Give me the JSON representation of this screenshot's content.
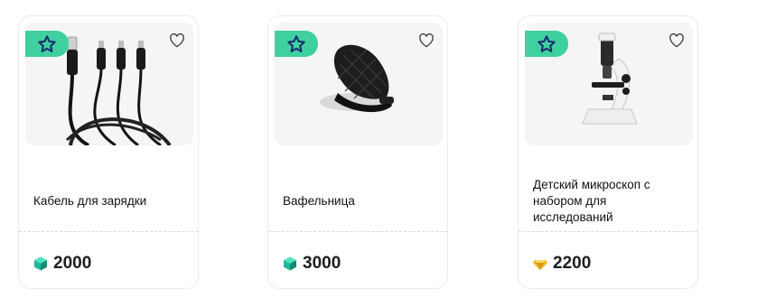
{
  "products": [
    {
      "title": "Кабель для зарядки",
      "price": "2000",
      "currency_icon": "green-gem-icon",
      "badge_icon": "star-icon",
      "favorite_icon": "heart-outline-icon"
    },
    {
      "title": "Вафельница",
      "price": "3000",
      "currency_icon": "green-gem-icon",
      "badge_icon": "star-icon",
      "favorite_icon": "heart-outline-icon"
    },
    {
      "title": "Детский микроскоп с набором для исследований",
      "price": "2200",
      "currency_icon": "gold-crystal-icon",
      "badge_icon": "star-icon",
      "favorite_icon": "heart-outline-icon"
    }
  ],
  "colors": {
    "badge": "#3fd0a0",
    "star_outline": "#1b2a6b",
    "gem_green": "#1fb89a",
    "crystal_gold": "#f2b321"
  }
}
